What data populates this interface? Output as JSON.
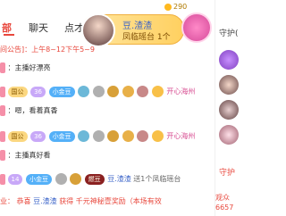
{
  "tabs": [
    {
      "label": "部"
    },
    {
      "label": "聊天"
    },
    {
      "label": "点才"
    }
  ],
  "header": {
    "coin_count": "290"
  },
  "gift_banner": {
    "user": "豆.渣渣",
    "desc": "凤临瑶台 1个"
  },
  "chat": {
    "notice": "间公告]：上午8~12下午5~9",
    "msg1": "：主播好漂亮",
    "msg2": "：嗯，看着真香",
    "msg3": "：主播真好看",
    "gift_row": {
      "user": "豆.渣渣",
      "text": "送1个凤临瑶台"
    },
    "bottom": {
      "prefix": "业：",
      "user1": "恭喜",
      "user2": "豆.渣渣",
      "text": "获得 千元神秘壹奖励（本场有效"
    },
    "badges": {
      "guo": "国公",
      "lvl_a": "36",
      "jd": "小金豆",
      "lvl_b": "14",
      "fans": "燃豆"
    },
    "kaixin": "开心海州"
  },
  "right": {
    "guard_title": "守护(",
    "guard_bottom": "守护",
    "viewer_label": "观众",
    "viewer_count": "6657"
  }
}
